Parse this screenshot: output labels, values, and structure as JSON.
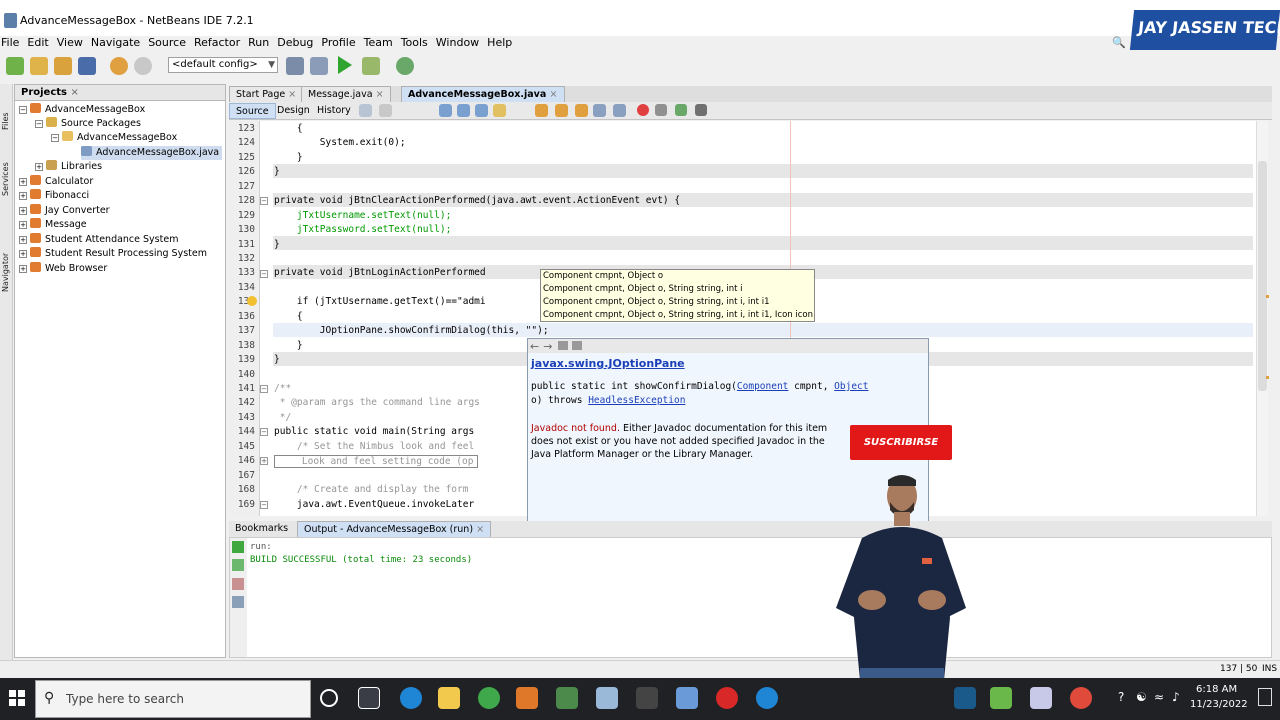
{
  "window": {
    "title": "AdvanceMessageBox - NetBeans IDE 7.2.1"
  },
  "brand": {
    "text": "JAY JASSEN TECH"
  },
  "menu": [
    "File",
    "Edit",
    "View",
    "Navigate",
    "Source",
    "Refactor",
    "Run",
    "Debug",
    "Profile",
    "Team",
    "Tools",
    "Window",
    "Help"
  ],
  "toolbar": {
    "config_value": "<default config>"
  },
  "side_tabs": [
    "Files",
    "Services",
    "Navigator"
  ],
  "projects": {
    "header": "Projects",
    "items": [
      {
        "label": "AdvanceMessageBox"
      },
      {
        "label": "Source Packages"
      },
      {
        "label": "AdvanceMessageBox"
      },
      {
        "label": "AdvanceMessageBox.java"
      },
      {
        "label": "Libraries"
      },
      {
        "label": "Calculator"
      },
      {
        "label": "Fibonacci"
      },
      {
        "label": "Jay Converter"
      },
      {
        "label": "Message"
      },
      {
        "label": "Student Attendance System"
      },
      {
        "label": "Student Result Processing System"
      },
      {
        "label": "Web Browser"
      }
    ]
  },
  "editor": {
    "tabs": [
      "Start Page",
      "Message.java",
      "AdvanceMessageBox.java"
    ],
    "subtabs": [
      "Source",
      "Design",
      "History"
    ],
    "lines": [
      {
        "num": "123",
        "text": "    {"
      },
      {
        "num": "124",
        "text": "        System.exit(0);"
      },
      {
        "num": "125",
        "text": "    }"
      },
      {
        "num": "126",
        "text": "}"
      },
      {
        "num": "127",
        "text": ""
      },
      {
        "num": "128",
        "text": "private void jBtnClearActionPerformed(java.awt.event.ActionEvent evt) {"
      },
      {
        "num": "129",
        "text": "    jTxtUsername.setText(null);"
      },
      {
        "num": "130",
        "text": "    jTxtPassword.setText(null);"
      },
      {
        "num": "131",
        "text": "}"
      },
      {
        "num": "132",
        "text": ""
      },
      {
        "num": "133",
        "text": "private void jBtnLoginActionPerformed"
      },
      {
        "num": "134",
        "text": ""
      },
      {
        "num": "135",
        "text": "    if (jTxtUsername.getText()==\"admi"
      },
      {
        "num": "136",
        "text": "    {"
      },
      {
        "num": "137",
        "text": "        JOptionPane.showConfirmDialog(this, \"\");"
      },
      {
        "num": "138",
        "text": "    }"
      },
      {
        "num": "139",
        "text": "}"
      },
      {
        "num": "140",
        "text": ""
      },
      {
        "num": "141",
        "text": "/**"
      },
      {
        "num": "142",
        "text": " * @param args the command line args"
      },
      {
        "num": "143",
        "text": " */"
      },
      {
        "num": "144",
        "text": "public static void main(String args"
      },
      {
        "num": "145",
        "text": "    /* Set the Nimbus look and feel"
      },
      {
        "num": "146",
        "text": "    Look and feel setting code (op"
      },
      {
        "num": "167",
        "text": ""
      },
      {
        "num": "168",
        "text": "    /* Create and display the form"
      },
      {
        "num": "169",
        "text": "    java.awt.EventQueue.invokeLater"
      }
    ]
  },
  "completion": {
    "items": [
      "Component cmpnt, Object o",
      "Component cmpnt, Object o, String string, int i",
      "Component cmpnt, Object o, String string, int i, int i1",
      "Component cmpnt, Object o, String string, int i, int i1, Icon icon"
    ]
  },
  "javadoc": {
    "class_link": "javax.swing.JOptionPane",
    "signature_prefix": "public static int showConfirmDialog(",
    "param1_type": "Component",
    "param1_name": " cmpnt, ",
    "param2_type": "Object",
    "signature_line2": "o) throws ",
    "exception": "HeadlessException",
    "notice_red": "Javadoc not found.",
    "notice_rest": " Either Javadoc documentation for this item does not exist or you have not added specified Javadoc in the Java Platform Manager or the Library Manager."
  },
  "subscribe": {
    "label": "SUSCRIBIRSE"
  },
  "bottom": {
    "tabs": [
      "Bookmarks",
      "Output - AdvanceMessageBox (run)"
    ],
    "output_lines": [
      "run:",
      "BUILD SUCCESSFUL (total time: 23 seconds)"
    ]
  },
  "status": {
    "position": "137 | 50",
    "mode": "INS"
  },
  "taskbar": {
    "search_placeholder": "Type here to search",
    "time": "6:18 AM",
    "date": "11/23/2022"
  }
}
